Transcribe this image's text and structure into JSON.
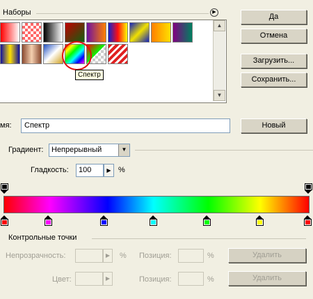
{
  "presets": {
    "title": "Наборы",
    "tooltip": "Спектр"
  },
  "buttons": {
    "ok": "Да",
    "cancel": "Отмена",
    "load": "Загрузить...",
    "save": "Сохранить...",
    "new": "Новый",
    "delete_opacity": "Удалить",
    "delete_color": "Удалить"
  },
  "name": {
    "label": "мя:",
    "value": "Спектр"
  },
  "gradient_type": {
    "label": "Градиент:",
    "value": "Непрерывный"
  },
  "smoothness": {
    "label": "Гладкость:",
    "value": "100",
    "unit": "%"
  },
  "stops": {
    "title": "Контрольные точки",
    "opacity_label": "Непрозрачность:",
    "opacity_unit": "%",
    "position_label": "Позиция:",
    "position_unit": "%",
    "color_label": "Цвет:",
    "position_label2": "Позиция:",
    "position_unit2": "%"
  },
  "color_stops": [
    "#ff0000",
    "#ff00ff",
    "#0000ff",
    "#00ffff",
    "#00ff00",
    "#ffff00",
    "#ff0000"
  ]
}
